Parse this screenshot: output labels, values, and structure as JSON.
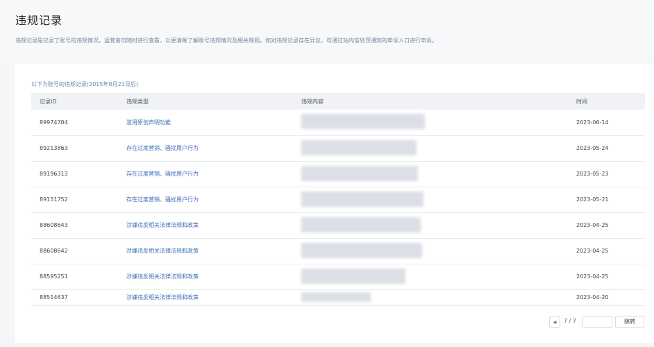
{
  "page": {
    "title": "违规记录",
    "description": "违规记录是记录了账号的违规情况。运营者可随时进行查看，以更清晰了解账号违规情况及相关规则。如对违规记录存在异议，可通过站内信处罚通知的申诉入口进行申诉。",
    "subnote": "以下为账号的违规记录(2015年8月21日后)"
  },
  "table": {
    "headers": [
      "记录ID",
      "违规类型",
      "违规内容",
      "时间"
    ],
    "rows": [
      {
        "id": "89974704",
        "type": "滥用原创声明功能",
        "content": "",
        "date": "2023-06-14"
      },
      {
        "id": "89213863",
        "type": "存在过度营销、骚扰用户行为",
        "content": "",
        "date": "2023-05-24"
      },
      {
        "id": "89196313",
        "type": "存在过度营销、骚扰用户行为",
        "content": "",
        "date": "2023-05-23"
      },
      {
        "id": "89151752",
        "type": "存在过度营销、骚扰用户行为",
        "content": "",
        "date": "2023-05-21"
      },
      {
        "id": "88608643",
        "type": "涉嫌违反相关法律法规和政策",
        "content": "",
        "date": "2023-04-25"
      },
      {
        "id": "88608642",
        "type": "涉嫌违反相关法律法规和政策",
        "content": "",
        "date": "2023-04-25"
      },
      {
        "id": "88595251",
        "type": "涉嫌违反相关法律法规和政策",
        "content": "",
        "date": "2023-04-25"
      },
      {
        "id": "88514637",
        "type": "涉嫌违反相关法律法规和政策",
        "content": "",
        "date": "2023-04-20"
      }
    ]
  },
  "pagination": {
    "prev_icon": "caret-left-icon",
    "page_count": "7 / 7",
    "jump_label": "跳转"
  }
}
